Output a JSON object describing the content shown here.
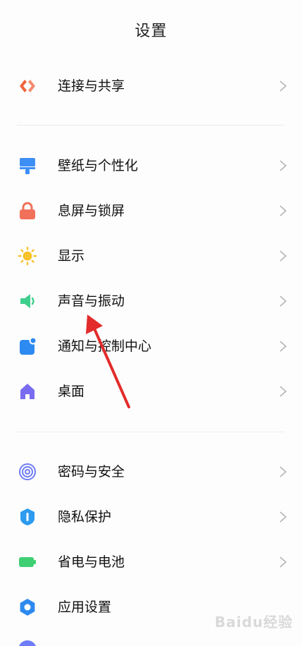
{
  "header": {
    "title": "设置"
  },
  "items": [
    {
      "label": "连接与共享",
      "icon": "share-icon",
      "color": "#f0643c"
    },
    {
      "label": "壁纸与个性化",
      "icon": "brush-icon",
      "color": "#3d8ef5"
    },
    {
      "label": "息屏与锁屏",
      "icon": "lock-icon",
      "color": "#f0705a"
    },
    {
      "label": "显示",
      "icon": "sun-icon",
      "color": "#f8c32b"
    },
    {
      "label": "声音与振动",
      "icon": "speaker-icon",
      "color": "#3ecf8e"
    },
    {
      "label": "通知与控制中心",
      "icon": "notification-icon",
      "color": "#2d8af0"
    },
    {
      "label": "桌面",
      "icon": "home-icon",
      "color": "#7a6cf0"
    },
    {
      "label": "密码与安全",
      "icon": "fingerprint-icon",
      "color": "#6e7df5"
    },
    {
      "label": "隐私保护",
      "icon": "shield-icon",
      "color": "#2d9bf0"
    },
    {
      "label": "省电与电池",
      "icon": "battery-icon",
      "color": "#3ecf72"
    },
    {
      "label": "应用设置",
      "icon": "gear-icon",
      "color": "#2d8af0"
    }
  ],
  "watermark": "Baidu经验"
}
